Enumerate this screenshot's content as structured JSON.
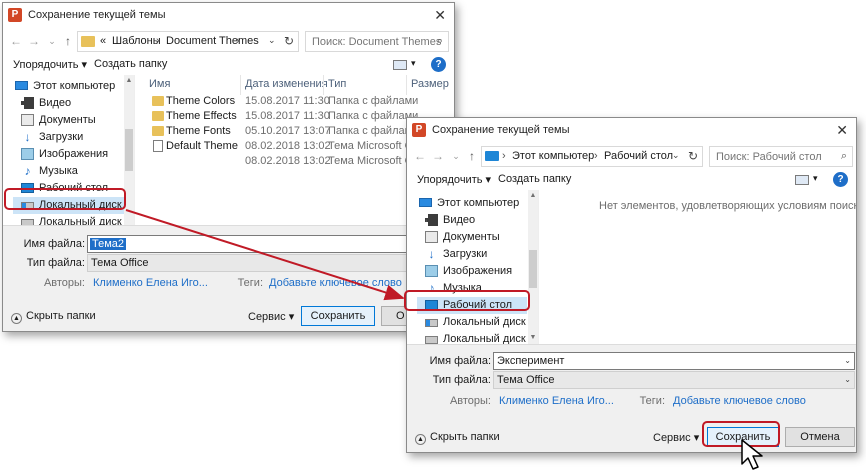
{
  "dialog1": {
    "title": "Сохранение текущей темы",
    "breadcrumb": {
      "prefix": "«",
      "items": [
        "Шаблоны",
        "Document Themes"
      ]
    },
    "search_placeholder": "Поиск: Document Themes",
    "toolbar": {
      "organize": "Упорядочить",
      "new_folder": "Создать папку"
    },
    "tree": [
      {
        "label": "Этот компьютер",
        "icon": "monitor-icon"
      },
      {
        "label": "Видео",
        "icon": "video-icon"
      },
      {
        "label": "Документы",
        "icon": "document-icon"
      },
      {
        "label": "Загрузки",
        "icon": "download-icon"
      },
      {
        "label": "Изображения",
        "icon": "image-icon"
      },
      {
        "label": "Музыка",
        "icon": "music-icon"
      },
      {
        "label": "Рабочий стол",
        "icon": "desktop-icon"
      },
      {
        "label": "Локальный диск (C:)",
        "icon": "drive-c-icon"
      },
      {
        "label": "Локальный диск (D:)",
        "icon": "drive-icon"
      }
    ],
    "columns": [
      "Имя",
      "Дата изменения",
      "Тип",
      "Размер"
    ],
    "files": [
      {
        "name": "Theme Colors",
        "date": "15.08.2017 11:30",
        "type": "Папка с файлами",
        "icon": "folder-icon"
      },
      {
        "name": "Theme Effects",
        "date": "15.08.2017 11:30",
        "type": "Папка с файлами",
        "icon": "folder-icon"
      },
      {
        "name": "Theme Fonts",
        "date": "05.10.2017 13:07",
        "type": "Папка с файлами",
        "icon": "folder-icon"
      },
      {
        "name": "Default Theme",
        "date": "08.02.2018 13:02",
        "type": "Тема Microsoft O...",
        "icon": "theme-file-icon"
      },
      {
        "name": "",
        "date": "08.02.2018 13:02",
        "type": "Тема Microsoft O...",
        "icon": ""
      }
    ],
    "form": {
      "filename_label": "Имя файла:",
      "filename_value": "Тема2",
      "filetype_label": "Тип файла:",
      "filetype_value": "Тема Office",
      "authors_label": "Авторы:",
      "authors_value": "Клименко Елена Иго...",
      "tags_label": "Теги:",
      "tags_value": "Добавьте ключевое слово"
    },
    "footer": {
      "hide_folders": "Скрыть папки",
      "service": "Сервис",
      "save": "Сохранить",
      "cancel_partial": "О"
    }
  },
  "dialog2": {
    "title": "Сохранение текущей темы",
    "breadcrumb": {
      "items": [
        "Этот компьютер",
        "Рабочий стол"
      ]
    },
    "search_placeholder": "Поиск: Рабочий стол",
    "toolbar": {
      "organize": "Упорядочить",
      "new_folder": "Создать папку"
    },
    "tree": [
      {
        "label": "Этот компьютер",
        "icon": "monitor-icon"
      },
      {
        "label": "Видео",
        "icon": "video-icon"
      },
      {
        "label": "Документы",
        "icon": "document-icon"
      },
      {
        "label": "Загрузки",
        "icon": "download-icon"
      },
      {
        "label": "Изображения",
        "icon": "image-icon"
      },
      {
        "label": "Музыка",
        "icon": "music-icon"
      },
      {
        "label": "Рабочий стол",
        "icon": "desktop-icon"
      },
      {
        "label": "Локальный диск (C:)",
        "icon": "drive-c-icon"
      },
      {
        "label": "Локальный диск (D:)",
        "icon": "drive-icon"
      }
    ],
    "empty_message": "Нет элементов, удовлетворяющих условиям поиска.",
    "form": {
      "filename_label": "Имя файла:",
      "filename_value": "Эксперимент",
      "filetype_label": "Тип файла:",
      "filetype_value": "Тема Office",
      "authors_label": "Авторы:",
      "authors_value": "Клименко Елена Иго...",
      "tags_label": "Теги:",
      "tags_value": "Добавьте ключевое слово"
    },
    "footer": {
      "hide_folders": "Скрыть папки",
      "service": "Сервис",
      "save": "Сохранить",
      "cancel": "Отмена"
    }
  },
  "colors": {
    "callout": "#c01a26",
    "selection": "#cce4f7",
    "link": "#1e6ec8"
  }
}
